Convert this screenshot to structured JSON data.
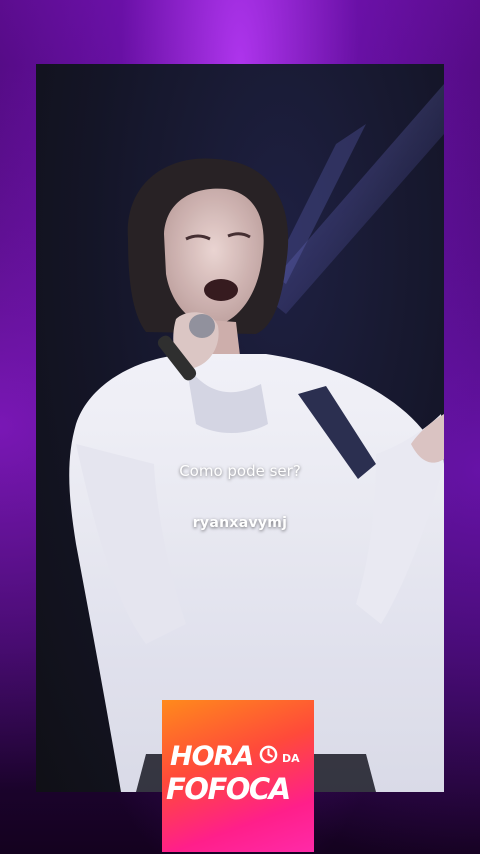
{
  "video": {
    "caption": "Como pode ser?",
    "username": "ryanxavymj"
  },
  "brand": {
    "logo_text": "HORA DA FOFOCA",
    "icon": "clock-icon",
    "gradient_colors": [
      "#ff8a1c",
      "#ff1f8a"
    ],
    "frame_color": "#5a0c8c"
  }
}
